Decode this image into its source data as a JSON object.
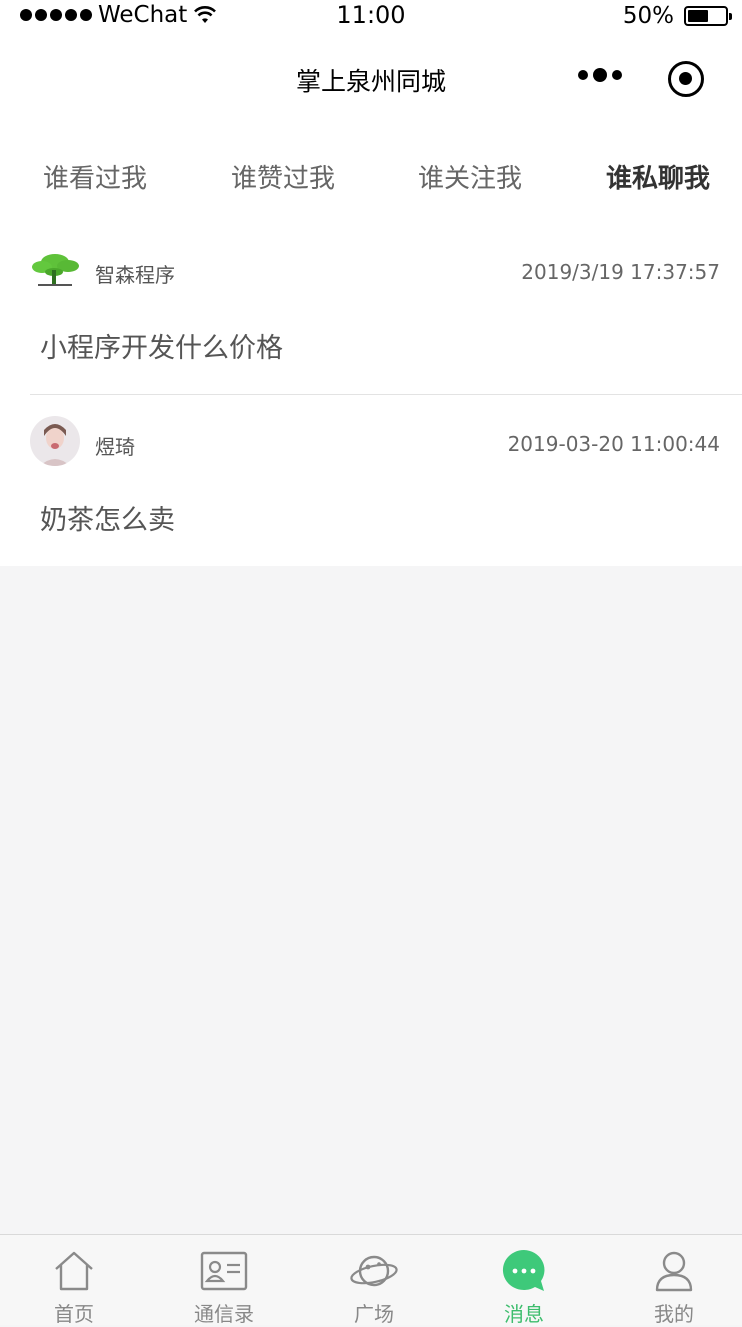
{
  "status_bar": {
    "carrier": "WeChat",
    "time": "11:00",
    "battery": "50%",
    "battery_level": 0.5
  },
  "nav": {
    "title": "掌上泉州同城",
    "more_icon": "more-dots-icon",
    "close_icon": "target-circle-icon"
  },
  "tabs": [
    {
      "label": "谁看过我",
      "active": false
    },
    {
      "label": "谁赞过我",
      "active": false
    },
    {
      "label": "谁关注我",
      "active": false
    },
    {
      "label": "谁私聊我",
      "active": true
    }
  ],
  "messages": [
    {
      "name": "智森程序",
      "time": "2019/3/19 17:37:57",
      "text": "小程序开发什么价格",
      "avatar": "tree-logo-avatar"
    },
    {
      "name": "煜琦",
      "time": "2019-03-20 11:00:44",
      "text": "奶茶怎么卖",
      "avatar": "person-photo-avatar"
    }
  ],
  "tabbar": {
    "items": [
      {
        "label": "首页",
        "icon": "home-icon",
        "active": false
      },
      {
        "label": "通信录",
        "icon": "contact-card-icon",
        "active": false
      },
      {
        "label": "广场",
        "icon": "planet-icon",
        "active": false
      },
      {
        "label": "消息",
        "icon": "chat-bubble-icon",
        "active": true
      },
      {
        "label": "我的",
        "icon": "user-icon",
        "active": false
      }
    ],
    "active_color": "#3dbd6d",
    "inactive_color": "#888888"
  }
}
